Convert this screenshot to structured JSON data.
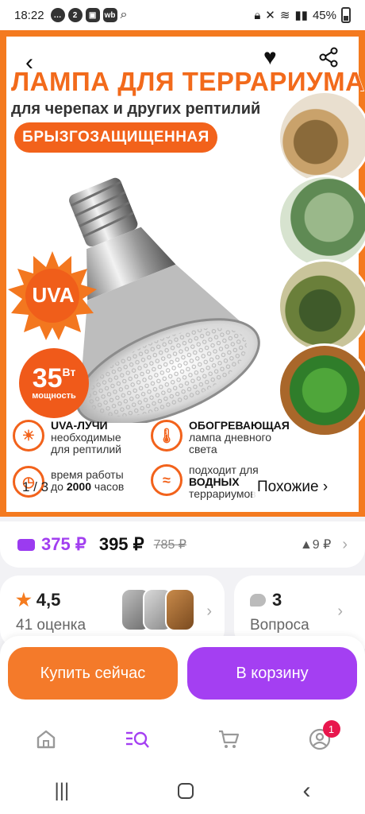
{
  "status_bar": {
    "time": "18:22",
    "battery": "45%",
    "badge_icon_text": "2",
    "wb_icon_text": "wb"
  },
  "banner": {
    "title": "ЛАМПА ДЛЯ ТЕРРАРИУМА",
    "subtitle": "для черепах и других рептилий",
    "pill": "БРЫЗГОЗАЩИЩЕННАЯ",
    "uva": "UVA",
    "watt_value": "35",
    "watt_unit": "Вт",
    "watt_caption": "мощность",
    "features": [
      {
        "title": "UVA-ЛУЧИ",
        "text1": "необходимые",
        "text2": "для рептилий"
      },
      {
        "title": "ОБОГРЕВАЮЩАЯ",
        "text1": "лампа дневного",
        "text2": "света"
      },
      {
        "text1": "время работы",
        "prefix": "до",
        "strong": "2000",
        "suffix": "часов"
      },
      {
        "text1": "подходит для",
        "title": "ВОДНЫХ",
        "text2": "террариумов"
      }
    ],
    "pager": "1 / 3",
    "similar": "Похожие ›"
  },
  "price": {
    "wallet_price": "375 ₽",
    "price": "395 ₽",
    "old_price": "785 ₽",
    "delta": "▲9 ₽"
  },
  "rating": {
    "value": "4,5",
    "count": "41 оценка"
  },
  "questions": {
    "count": "3",
    "label": "Вопроса"
  },
  "actions": {
    "buy_now": "Купить сейчас",
    "to_cart": "В корзину"
  },
  "bottom_nav": {
    "profile_badge": "1"
  },
  "colors": {
    "accent_orange": "#f47a2a",
    "accent_purple": "#a43ff2",
    "badge_red": "#e8174d"
  }
}
